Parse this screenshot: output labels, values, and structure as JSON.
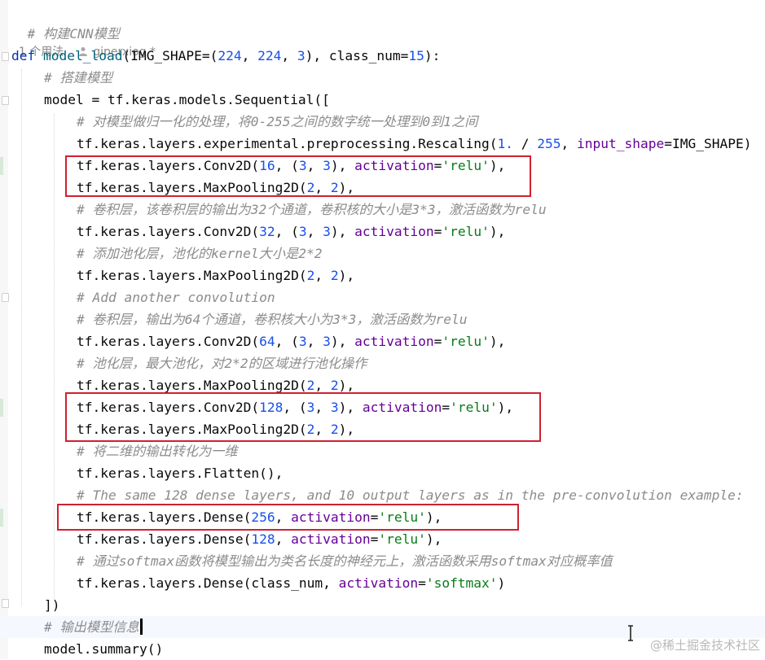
{
  "editor": {
    "header_comment": "# 构建CNN模型",
    "usage_info": {
      "usages": "1 个用法",
      "author": "giperxiog *"
    },
    "lines": [
      {
        "parts": [
          [
            "kw",
            "def "
          ],
          [
            "fn",
            "model_load"
          ],
          [
            "",
            "(IMG_SHAPE=("
          ],
          [
            "num",
            "224"
          ],
          [
            "",
            ", "
          ],
          [
            "num",
            "224"
          ],
          [
            "",
            ", "
          ],
          [
            "num",
            "3"
          ],
          [
            "",
            "), class_num="
          ],
          [
            "num",
            "15"
          ],
          [
            "",
            "):"
          ]
        ]
      },
      {
        "parts": [
          [
            "cm",
            "# 搭建模型"
          ]
        ]
      },
      {
        "parts": [
          [
            "",
            "model = tf.keras.models.Sequential(["
          ]
        ]
      },
      {
        "parts": [
          [
            "cm",
            "# 对模型做归一化的处理，将0-255之间的数字统一处理到0到1之间"
          ]
        ]
      },
      {
        "parts": [
          [
            "",
            "tf.keras.layers.experimental.preprocessing.Rescaling("
          ],
          [
            "num",
            "1."
          ],
          [
            "",
            " / "
          ],
          [
            "num",
            "255"
          ],
          [
            "",
            ", "
          ],
          [
            "kwarg",
            "input_shape"
          ],
          [
            "",
            "=IMG_SHAPE)"
          ]
        ]
      },
      {
        "parts": [
          [
            "",
            "tf.keras.layers.Conv2D("
          ],
          [
            "num",
            "16"
          ],
          [
            "",
            ", ("
          ],
          [
            "num",
            "3"
          ],
          [
            "",
            ", "
          ],
          [
            "num",
            "3"
          ],
          [
            "",
            "), "
          ],
          [
            "kwarg",
            "activation"
          ],
          [
            "",
            "="
          ],
          [
            "str",
            "'relu'"
          ],
          [
            "",
            "),"
          ]
        ]
      },
      {
        "parts": [
          [
            "",
            "tf.keras.layers.MaxPooling2D("
          ],
          [
            "num",
            "2"
          ],
          [
            "",
            ", "
          ],
          [
            "num",
            "2"
          ],
          [
            "",
            "),"
          ]
        ]
      },
      {
        "parts": [
          [
            "cm",
            "# 卷积层，该卷积层的输出为32个通道，卷积核的大小是3*3，激活函数为relu"
          ]
        ]
      },
      {
        "parts": [
          [
            "",
            "tf.keras.layers.Conv2D("
          ],
          [
            "num",
            "32"
          ],
          [
            "",
            ", ("
          ],
          [
            "num",
            "3"
          ],
          [
            "",
            ", "
          ],
          [
            "num",
            "3"
          ],
          [
            "",
            "), "
          ],
          [
            "kwarg",
            "activation"
          ],
          [
            "",
            "="
          ],
          [
            "str",
            "'relu'"
          ],
          [
            "",
            "),"
          ]
        ]
      },
      {
        "parts": [
          [
            "cm",
            "# 添加池化层，池化的kernel大小是2*2"
          ]
        ]
      },
      {
        "parts": [
          [
            "",
            "tf.keras.layers.MaxPooling2D("
          ],
          [
            "num",
            "2"
          ],
          [
            "",
            ", "
          ],
          [
            "num",
            "2"
          ],
          [
            "",
            "),"
          ]
        ]
      },
      {
        "parts": [
          [
            "cm",
            "# Add another convolution"
          ]
        ]
      },
      {
        "parts": [
          [
            "cm",
            "# 卷积层，输出为64个通道，卷积核大小为3*3，激活函数为relu"
          ]
        ]
      },
      {
        "parts": [
          [
            "",
            "tf.keras.layers.Conv2D("
          ],
          [
            "num",
            "64"
          ],
          [
            "",
            ", ("
          ],
          [
            "num",
            "3"
          ],
          [
            "",
            ", "
          ],
          [
            "num",
            "3"
          ],
          [
            "",
            "), "
          ],
          [
            "kwarg",
            "activation"
          ],
          [
            "",
            "="
          ],
          [
            "str",
            "'relu'"
          ],
          [
            "",
            "),"
          ]
        ]
      },
      {
        "parts": [
          [
            "cm",
            "# 池化层，最大池化，对2*2的区域进行池化操作"
          ]
        ]
      },
      {
        "parts": [
          [
            "",
            "tf.keras.layers.MaxPooling2D("
          ],
          [
            "num",
            "2"
          ],
          [
            "",
            ", "
          ],
          [
            "num",
            "2"
          ],
          [
            "",
            "),"
          ]
        ]
      },
      {
        "parts": [
          [
            "",
            "tf.keras.layers.Conv2D("
          ],
          [
            "num",
            "128"
          ],
          [
            "",
            ", ("
          ],
          [
            "num",
            "3"
          ],
          [
            "",
            ", "
          ],
          [
            "num",
            "3"
          ],
          [
            "",
            "), "
          ],
          [
            "kwarg",
            "activation"
          ],
          [
            "",
            "="
          ],
          [
            "str",
            "'relu'"
          ],
          [
            "",
            "),"
          ]
        ]
      },
      {
        "parts": [
          [
            "",
            "tf.keras.layers.MaxPooling2D("
          ],
          [
            "num",
            "2"
          ],
          [
            "",
            ", "
          ],
          [
            "num",
            "2"
          ],
          [
            "",
            "),"
          ]
        ]
      },
      {
        "parts": [
          [
            "cm",
            "# 将二维的输出转化为一维"
          ]
        ]
      },
      {
        "parts": [
          [
            "",
            "tf.keras.layers.Flatten(),"
          ]
        ]
      },
      {
        "parts": [
          [
            "cm",
            "# The same 128 dense layers, and 10 output layers as in the pre-convolution example:"
          ]
        ]
      },
      {
        "parts": [
          [
            "",
            "tf.keras.layers.Dense("
          ],
          [
            "num",
            "256"
          ],
          [
            "",
            ", "
          ],
          [
            "kwarg",
            "activation"
          ],
          [
            "",
            "="
          ],
          [
            "str",
            "'relu'"
          ],
          [
            "",
            "),"
          ]
        ]
      },
      {
        "parts": [
          [
            "",
            "tf.keras.layers.Dense("
          ],
          [
            "num",
            "128"
          ],
          [
            "",
            ", "
          ],
          [
            "kwarg",
            "activation"
          ],
          [
            "",
            "="
          ],
          [
            "str",
            "'relu'"
          ],
          [
            "",
            "),"
          ]
        ]
      },
      {
        "parts": [
          [
            "cm",
            "# 通过softmax函数将模型输出为类名长度的神经元上，激活函数采用softmax对应概率值"
          ]
        ]
      },
      {
        "parts": [
          [
            "",
            "tf.keras.layers.Dense(class_num, "
          ],
          [
            "kwarg",
            "activation"
          ],
          [
            "",
            "="
          ],
          [
            "str",
            "'softmax'"
          ],
          [
            "",
            ")"
          ]
        ]
      },
      {
        "parts": [
          [
            "",
            "])"
          ]
        ]
      },
      {
        "parts": [
          [
            "cm",
            "# 输出模型信息"
          ]
        ]
      },
      {
        "parts": [
          [
            "",
            "model.summary()"
          ]
        ]
      }
    ]
  },
  "watermark": "@稀土掘金技术社区",
  "colors": {
    "keyword": "#0033b3",
    "function": "#00627a",
    "number": "#1750eb",
    "kwarg": "#660099",
    "string": "#067d17",
    "comment": "#8c8c8c",
    "highlight_box": "#d0212e"
  }
}
